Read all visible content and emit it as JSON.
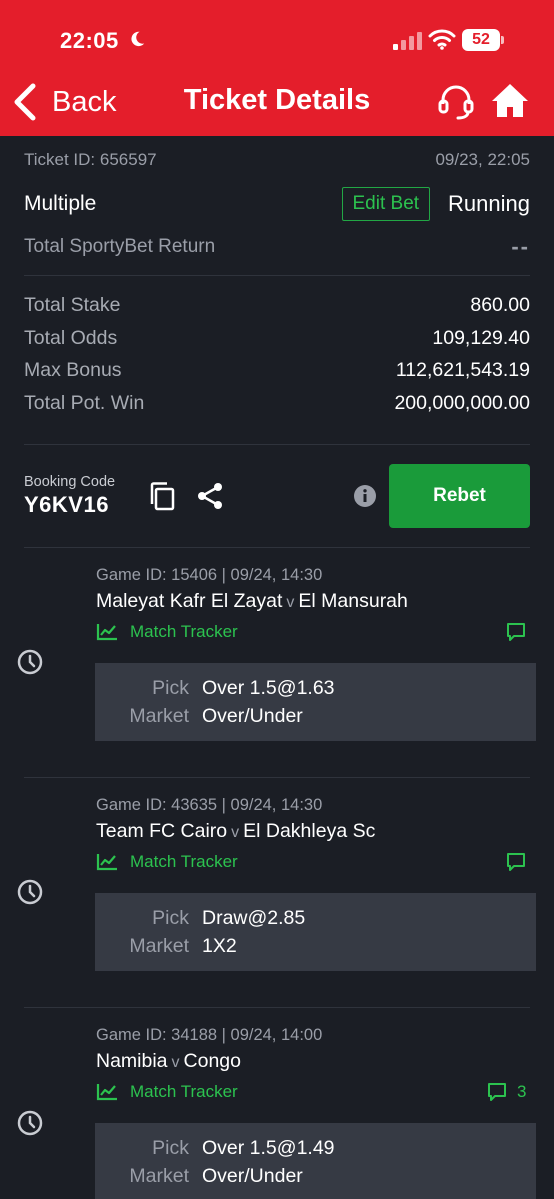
{
  "status_bar": {
    "time": "22:05",
    "battery": "52"
  },
  "nav": {
    "back_label": "Back",
    "title": "Ticket Details"
  },
  "ticket": {
    "id_text": "Ticket ID: 656597",
    "datetime": "09/23, 22:05",
    "type": "Multiple",
    "edit_bet_label": "Edit Bet",
    "status": "Running",
    "return_label": "Total SportyBet Return",
    "return_value": "--"
  },
  "stats": [
    {
      "label": "Total Stake",
      "value": "860.00"
    },
    {
      "label": "Total Odds",
      "value": "109,129.40"
    },
    {
      "label": "Max Bonus",
      "value": "112,621,543.19"
    },
    {
      "label": "Total Pot. Win",
      "value": "200,000,000.00"
    }
  ],
  "booking": {
    "label": "Booking Code",
    "code": "Y6KV16",
    "rebet_label": "Rebet"
  },
  "selections": [
    {
      "game_id": "Game ID: 15406 | 09/24, 14:30",
      "home": "Maleyat Kafr El Zayat",
      "vs": "v",
      "away": "El Mansurah",
      "tracker_label": "Match Tracker",
      "comments": "",
      "pick_label": "Pick",
      "pick": "Over 1.5@1.63",
      "market_label": "Market",
      "market": "Over/Under"
    },
    {
      "game_id": "Game ID: 43635 | 09/24, 14:30",
      "home": "Team FC Cairo",
      "vs": "v",
      "away": "El Dakhleya Sc",
      "tracker_label": "Match Tracker",
      "comments": "",
      "pick_label": "Pick",
      "pick": "Draw@2.85",
      "market_label": "Market",
      "market": "1X2"
    },
    {
      "game_id": "Game ID: 34188 | 09/24, 14:00",
      "home": "Namibia",
      "vs": "v",
      "away": "Congo",
      "tracker_label": "Match Tracker",
      "comments": "3",
      "pick_label": "Pick",
      "pick": "Over 1.5@1.49",
      "market_label": "Market",
      "market": "Over/Under"
    }
  ],
  "colors": {
    "header": "#e41e2b",
    "background": "#1b1e25",
    "accent_green": "#2cc24f",
    "rebet_green": "#1a9b3a",
    "pick_box": "#363a44"
  }
}
